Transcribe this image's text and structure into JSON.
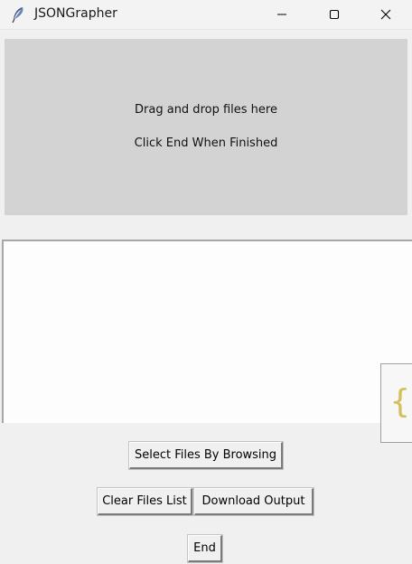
{
  "window": {
    "title": "JSONGrapher",
    "app_icon": "feather-icon",
    "controls": [
      "minimize-icon",
      "maximize-icon",
      "close-icon"
    ]
  },
  "dropzone": {
    "line1": "Drag and drop files here",
    "line2": "Click End When Finished"
  },
  "files_list": {
    "items": []
  },
  "side_tab": {
    "glyph": "{",
    "color": "#d4bf5a"
  },
  "buttons": {
    "select_files": "Select Files By Browsing",
    "clear_files": "Clear Files List",
    "download_output": "Download Output",
    "end": "End"
  }
}
